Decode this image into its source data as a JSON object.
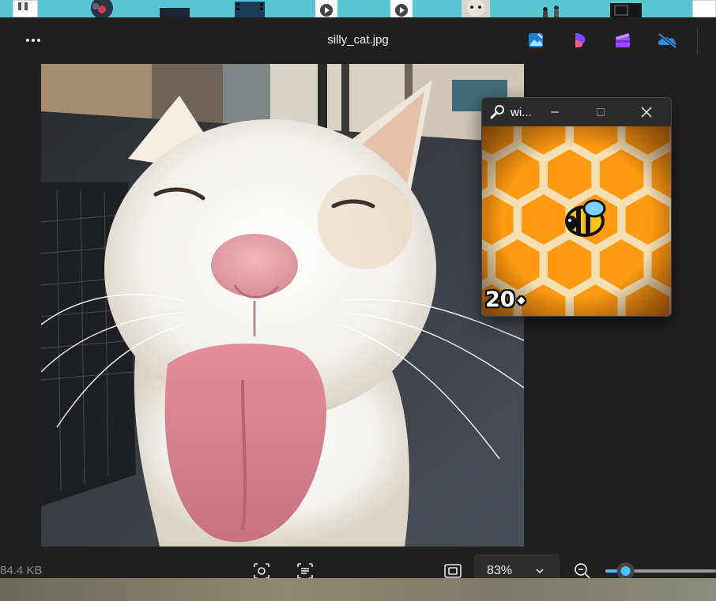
{
  "desktop": {
    "background_color": "#57c7d4",
    "icons": [
      "document-icon",
      "character-icon",
      "video-thumbnail-icon",
      "video-thumbnail-icon",
      "media-file-icon",
      "media-file-icon",
      "face-thumbnail-icon",
      "figures-thumbnail-icon",
      "dark-thumbnail-icon",
      "document-icon"
    ]
  },
  "viewer": {
    "file_name": "silly_cat.jpg",
    "more_icon": "more-options-icon",
    "apps": [
      "image-editor-icon",
      "clipchamp-design-icon",
      "clipchamp-video-icon",
      "onedrive-icon"
    ],
    "image_subject": "white cat with tongue out",
    "file_size": "84.4 KB",
    "toolbar": {
      "visual_search_icon": "visual-search-icon",
      "text_scan_icon": "text-scan-icon",
      "actual_size_icon": "actual-size-icon",
      "zoom_out_icon": "zoom-out-icon"
    },
    "zoom": {
      "value": "83%",
      "slider_level": 0.14
    },
    "accent_color": "#4cc2ff"
  },
  "mini_window": {
    "title": "wi...",
    "title_icon": "wrench-icon",
    "controls": [
      "minimize-icon",
      "maximize-icon",
      "close-icon"
    ],
    "game": {
      "score": "20",
      "score_icon": "diamond-icon",
      "sprite": "bee",
      "honey_color": "#ff9a12",
      "comb_color": "#f6dfb2"
    }
  }
}
